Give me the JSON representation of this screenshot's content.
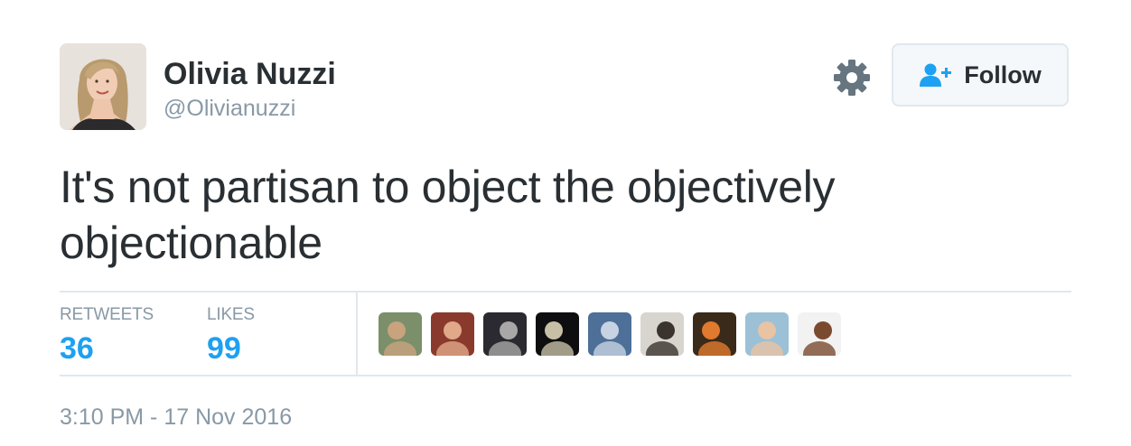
{
  "author": {
    "display_name": "Olivia Nuzzi",
    "handle": "@Olivianuzzi",
    "avatar_icon": "profile-photo"
  },
  "actions": {
    "settings_icon": "gear-icon",
    "follow_label": "Follow",
    "follow_icon": "add-user-icon"
  },
  "tweet": {
    "text": "It's not partisan to object the objectively objectionable"
  },
  "stats": {
    "retweets_label": "RETWEETS",
    "retweets_count": "36",
    "likes_label": "LIKES",
    "likes_count": "99"
  },
  "likers": [
    {
      "icon": "liker-avatar-1",
      "colors": [
        "#7a8f6a",
        "#c9a27e"
      ]
    },
    {
      "icon": "liker-avatar-2",
      "colors": [
        "#8a3a2c",
        "#e0a98a"
      ]
    },
    {
      "icon": "liker-avatar-3",
      "colors": [
        "#2a2a30",
        "#a9a7a8"
      ]
    },
    {
      "icon": "liker-avatar-4",
      "colors": [
        "#0e0e10",
        "#c7c0a6"
      ]
    },
    {
      "icon": "liker-avatar-5",
      "colors": [
        "#4d6f98",
        "#c7d3e2"
      ]
    },
    {
      "icon": "liker-avatar-6",
      "colors": [
        "#d8d5cf",
        "#3a342d"
      ]
    },
    {
      "icon": "liker-avatar-7",
      "colors": [
        "#3a2a1a",
        "#e07a2e"
      ]
    },
    {
      "icon": "liker-avatar-8",
      "colors": [
        "#9cc0d6",
        "#e8c3a4"
      ]
    },
    {
      "icon": "liker-avatar-9",
      "colors": [
        "#f2f2f2",
        "#7a4a30"
      ]
    }
  ],
  "timestamp": "3:10 PM - 17 Nov 2016",
  "colors": {
    "text_primary": "#292f33",
    "text_secondary": "#8899a6",
    "accent": "#1da1f2",
    "divider": "#e1e8ed"
  }
}
